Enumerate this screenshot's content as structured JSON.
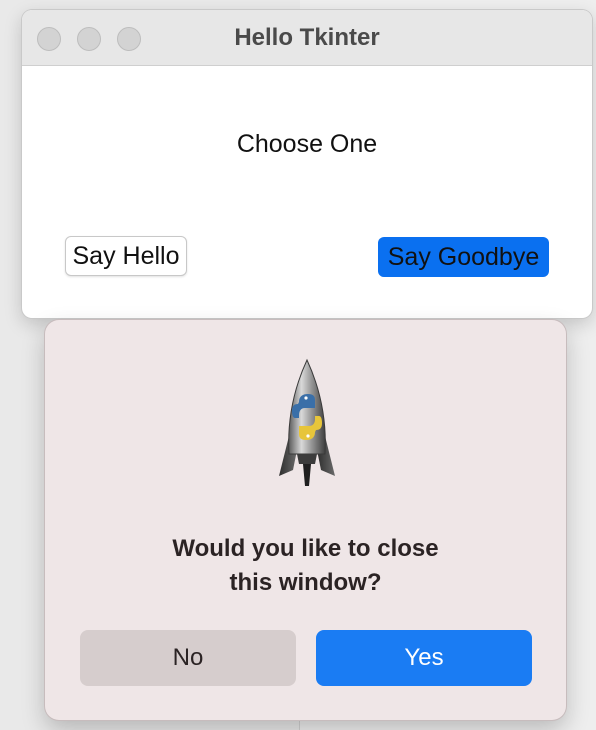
{
  "window": {
    "title": "Hello Tkinter",
    "prompt": "Choose One",
    "buttons": {
      "hello": "Say Hello",
      "goodbye": "Say Goodbye"
    },
    "accent_color": "#0a70f0"
  },
  "dialog": {
    "icon": "python-launcher-rocket-icon",
    "message_line1": "Would you like to close",
    "message_line2": "this window?",
    "buttons": {
      "no": "No",
      "yes": "Yes"
    },
    "default_button_color": "#1a7cf3"
  }
}
